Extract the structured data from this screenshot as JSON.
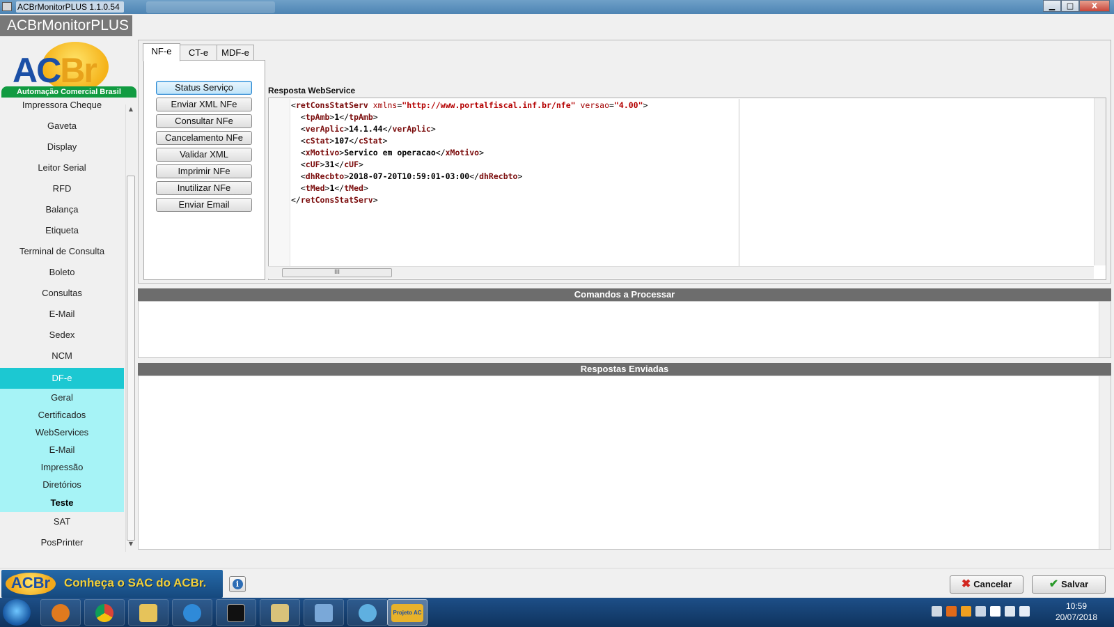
{
  "window": {
    "title": "ACBrMonitorPLUS 1.1.0.54",
    "app_name": "ACBrMonitorPLUS",
    "controls": {
      "minimize": "▁",
      "maximize": "□",
      "close": "X"
    }
  },
  "logo": {
    "letters_ac": "AC",
    "letters_br": "Br",
    "tagline": "Automação Comercial Brasil"
  },
  "sidebar": {
    "items": [
      {
        "label": "Impressora Cheque"
      },
      {
        "label": "Gaveta"
      },
      {
        "label": "Display"
      },
      {
        "label": "Leitor Serial"
      },
      {
        "label": "RFD"
      },
      {
        "label": "Balança"
      },
      {
        "label": "Etiqueta"
      },
      {
        "label": "Terminal de Consulta"
      },
      {
        "label": "Boleto"
      },
      {
        "label": "Consultas"
      },
      {
        "label": "E-Mail"
      },
      {
        "label": "Sedex"
      },
      {
        "label": "NCM"
      },
      {
        "label": "DF-e"
      },
      {
        "label": "Geral"
      },
      {
        "label": "Certificados"
      },
      {
        "label": "WebServices"
      },
      {
        "label": "E-Mail"
      },
      {
        "label": "Impressão"
      },
      {
        "label": "Diretórios"
      },
      {
        "label": "Teste"
      },
      {
        "label": "SAT"
      },
      {
        "label": "PosPrinter"
      }
    ],
    "active_item": "DF-e",
    "selected_subitem": "Teste"
  },
  "tabs": [
    {
      "label": "NF-e",
      "active": true
    },
    {
      "label": "CT-e",
      "active": false
    },
    {
      "label": "MDF-e",
      "active": false
    }
  ],
  "actions": [
    {
      "label": "Status Serviço",
      "focused": true
    },
    {
      "label": "Enviar XML NFe"
    },
    {
      "label": "Consultar NFe"
    },
    {
      "label": "Cancelamento NFe"
    },
    {
      "label": "Validar XML"
    },
    {
      "label": "Imprimir NFe"
    },
    {
      "label": "Inutilizar NFe"
    },
    {
      "label": "Enviar Email"
    }
  ],
  "response": {
    "label": "Resposta WebService",
    "xml": {
      "root": "retConsStatServ",
      "xmlns_attr": "xmlns",
      "xmlns": "\"http://www.portalfiscal.inf.br/nfe\"",
      "versao_attr": "versao",
      "versao": "\"4.00\"",
      "fields": [
        {
          "tag": "tpAmb",
          "value": "1"
        },
        {
          "tag": "verAplic",
          "value": "14.1.44"
        },
        {
          "tag": "cStat",
          "value": "107"
        },
        {
          "tag": "xMotivo",
          "value": "Servico em operacao"
        },
        {
          "tag": "cUF",
          "value": "31"
        },
        {
          "tag": "dhRecbto",
          "value": "2018-07-20T10:59:01-03:00"
        },
        {
          "tag": "tMed",
          "value": "1"
        }
      ]
    },
    "hscroll_thumb_glyph": "III"
  },
  "commands_section": {
    "title": "Comandos a Processar"
  },
  "responses_section": {
    "title": "Respostas Enviadas"
  },
  "footer": {
    "sac_logo": "ACBr",
    "sac_label": "Conheça o SAC do ACBr.",
    "info_glyph": "i",
    "cancel_label": "Cancelar",
    "save_label": "Salvar"
  },
  "taskbar": {
    "time": "10:59",
    "date": "20/07/2018",
    "active_task_label": "Projeto AC"
  }
}
